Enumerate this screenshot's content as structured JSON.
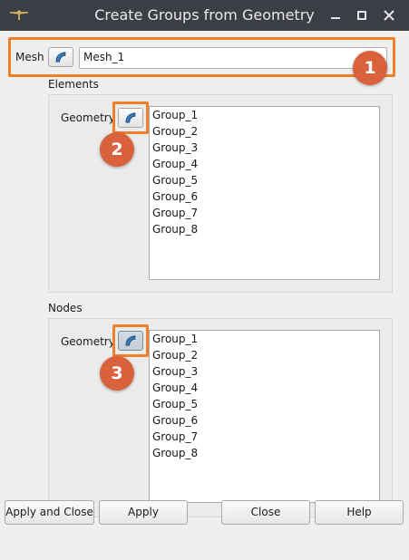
{
  "window": {
    "title": "Create Groups from Geometry",
    "controls": {
      "minimize": "–",
      "maximize": "□",
      "close": "✕"
    }
  },
  "mesh": {
    "label": "Mesh",
    "value": "Mesh_1",
    "select_icon": "geometry-select-icon"
  },
  "elements": {
    "section_title": "Elements",
    "geometry_label": "Geometry",
    "select_icon": "geometry-select-icon",
    "items": [
      "Group_1",
      "Group_2",
      "Group_3",
      "Group_4",
      "Group_5",
      "Group_6",
      "Group_7",
      "Group_8"
    ]
  },
  "nodes": {
    "section_title": "Nodes",
    "geometry_label": "Geometry",
    "select_icon": "geometry-select-icon",
    "items": [
      "Group_1",
      "Group_2",
      "Group_3",
      "Group_4",
      "Group_5",
      "Group_6",
      "Group_7",
      "Group_8"
    ]
  },
  "annotations": {
    "badge_1": "1",
    "badge_2": "2",
    "badge_3": "3",
    "highlight_color": "#f07f2a",
    "badge_color": "#d9623c"
  },
  "buttons": {
    "apply_and_close": "Apply and Close",
    "apply": "Apply",
    "close": "Close",
    "help": "Help"
  }
}
